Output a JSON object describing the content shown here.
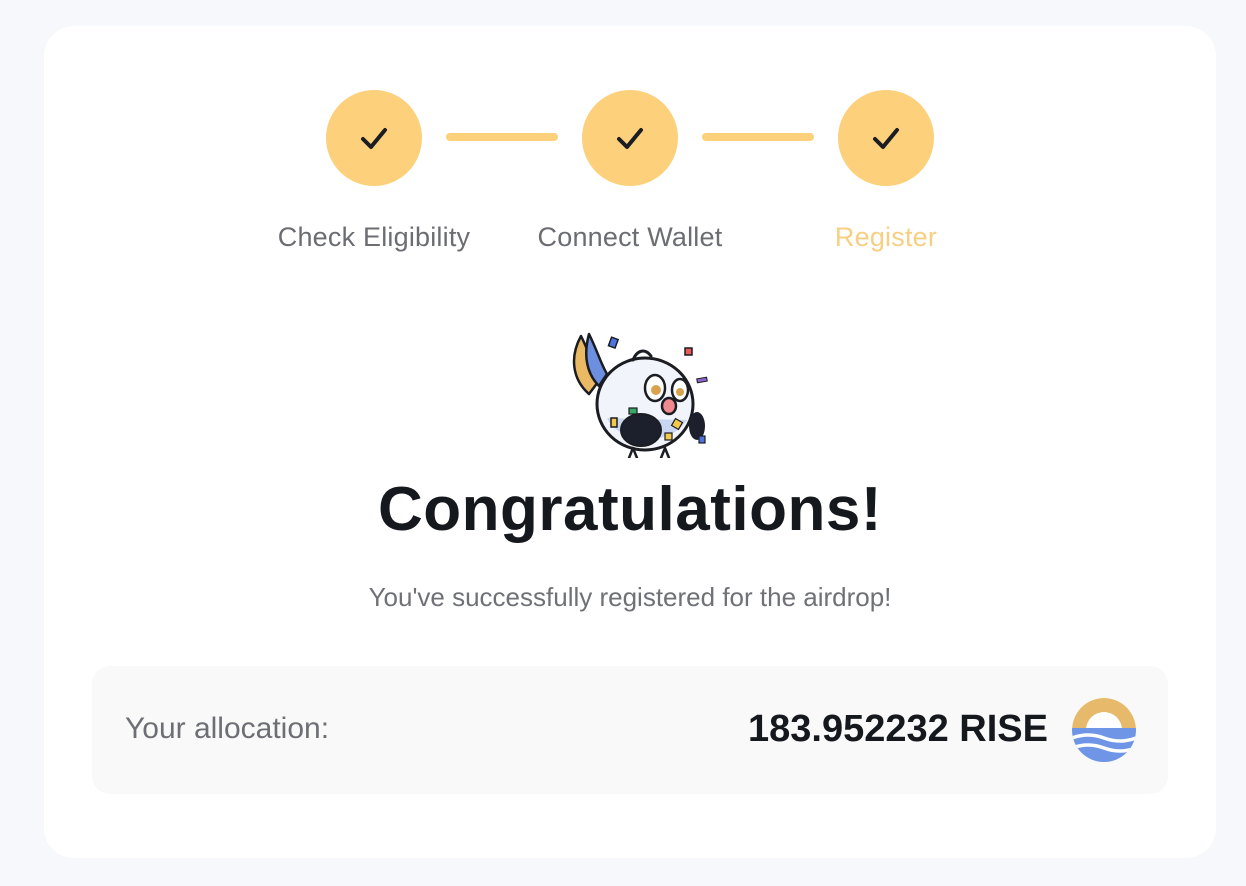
{
  "stepper": {
    "steps": [
      {
        "label": "Check Eligibility",
        "status": "complete"
      },
      {
        "label": "Connect Wallet",
        "status": "complete"
      },
      {
        "label": "Register",
        "status": "current-complete"
      }
    ],
    "colors": {
      "circle": "#fdd07c",
      "active_label": "#f7cf83",
      "label": "#6b6d72"
    }
  },
  "mascot": {
    "icon": "celebrating-bird-mascot-icon"
  },
  "success": {
    "title": "Congratulations!",
    "message": "You've successfully registered for the airdrop!"
  },
  "allocation": {
    "label": "Your allocation:",
    "amount": "183.952232 RISE",
    "token_icon": "rise-token-icon"
  }
}
